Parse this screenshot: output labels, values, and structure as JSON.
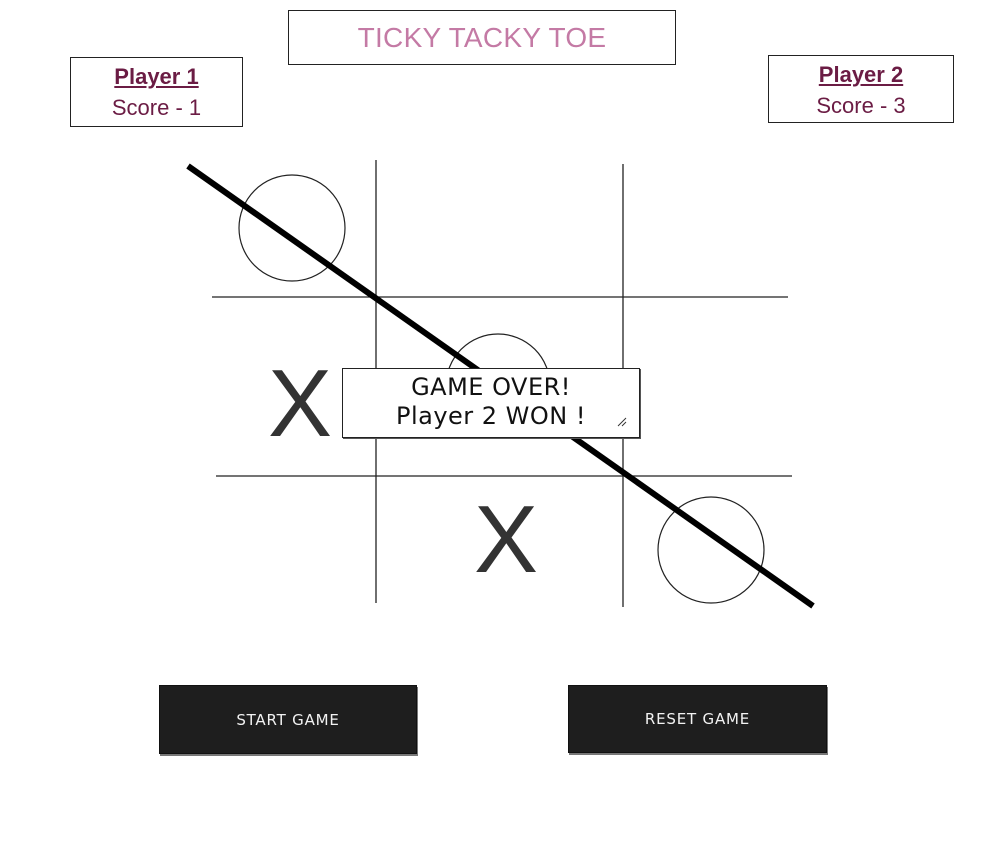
{
  "title": "TICKY TACKY TOE",
  "players": [
    {
      "name": "Player 1 ",
      "score_text": "Score - 1"
    },
    {
      "name": "Player 2",
      "score_text": "Score - 3"
    }
  ],
  "board": {
    "cells": [
      "O",
      "",
      "",
      "X",
      "O",
      "",
      "",
      "X",
      "O"
    ],
    "winning_line": "diagonal top-left to bottom-right"
  },
  "game_over": {
    "line1": "GAME OVER!",
    "line2": "Player 2 WON !"
  },
  "buttons": {
    "start": "START GAME",
    "reset": "RESET GAME"
  },
  "colors": {
    "title": "#c47aa5",
    "player_text": "#6b1c44",
    "button_bg": "#1e1e1e",
    "button_text": "#f2f2f2"
  }
}
